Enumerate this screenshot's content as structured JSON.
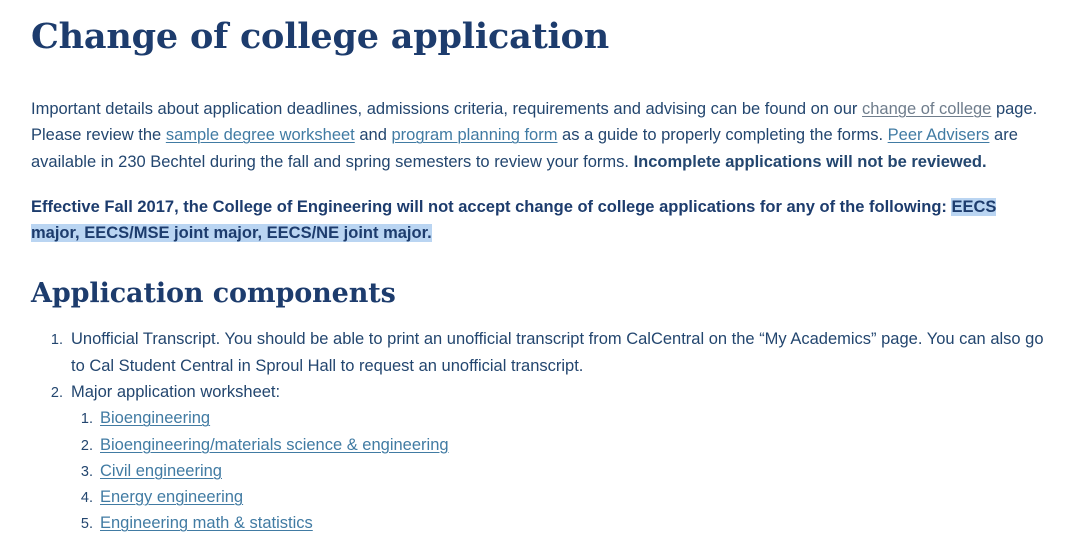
{
  "page": {
    "title": "Change of college application"
  },
  "intro": {
    "seg1": "Important details about application deadlines, admissions criteria, requirements and advising can be found on our ",
    "link_change_of_college": "change of college",
    "seg2": " page. Please review the ",
    "link_sample_degree_worksheet": "sample degree worksheet",
    "seg3": " and ",
    "link_program_planning_form": "program planning form",
    "seg4": " as a guide to properly completing the forms. ",
    "link_peer_advisers": "Peer Advisers",
    "seg5": " are available in 230 Bechtel during the fall and spring semesters to review your forms. ",
    "bold_tail": "Incomplete applications will not be reviewed."
  },
  "notice": {
    "text_unselected": "Effective Fall 2017, the College of Engineering will not accept change of college applications for any of the following: ",
    "text_selected": "EECS major, EECS/MSE joint major, EECS/NE joint major.",
    "highlight_color": "#bad5f2"
  },
  "components": {
    "heading": "Application components",
    "items": [
      {
        "text": "Unofficial Transcript. You should be able to print an unofficial transcript from CalCentral on the “My Academics” page.  You can also go to Cal Student Central in Sproul Hall to request an unofficial transcript."
      },
      {
        "text": "Major application worksheet:",
        "majors": [
          "Bioengineering ",
          "Bioengineering/materials science & engineering",
          "Civil engineering",
          "Energy engineering",
          "Engineering math & statistics"
        ]
      }
    ]
  },
  "colors": {
    "heading_navy": "#1d3c6d",
    "body_navy": "#23466f",
    "link_blue": "#417ba3",
    "link_muted": "#6f7d8c",
    "background": "#ffffff"
  }
}
